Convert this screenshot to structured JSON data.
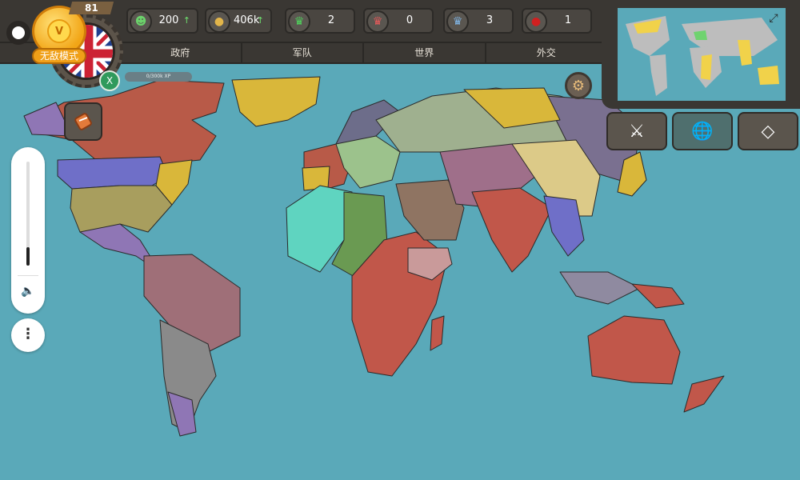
{
  "player": {
    "level": "81",
    "mode_label": "无敌模式",
    "medal_letter": "V",
    "x_badge": "X",
    "xp_text": "0/300k XP"
  },
  "stats": [
    {
      "icon": "happiness-icon",
      "glyph": "☻",
      "color": "#6bd36b",
      "value": "200",
      "trend": "↑"
    },
    {
      "icon": "gold-coins-icon",
      "glyph": "●",
      "color": "#e2b54a",
      "value": "406k",
      "trend": "↑"
    },
    {
      "icon": "green-crown-icon",
      "glyph": "♛",
      "color": "#4fd25c",
      "value": "2",
      "trend": ""
    },
    {
      "icon": "red-crown-icon",
      "glyph": "♛",
      "color": "#e05a5a",
      "value": "0",
      "trend": ""
    },
    {
      "icon": "blue-crown-icon",
      "glyph": "♛",
      "color": "#7fb2e0",
      "value": "3",
      "trend": ""
    },
    {
      "icon": "japan-flag-icon",
      "glyph": "●",
      "color": "#d02020",
      "value": "1",
      "trend": ""
    }
  ],
  "tabs": [
    "政府",
    "军队",
    "世界",
    "外交"
  ],
  "colors": {
    "ocean": "#5aa9b9",
    "panel": "#3a3733",
    "player_red": "#c1574a",
    "gold": "#f0a018"
  },
  "icons": {
    "zoom_speaker": "speaker-icon",
    "more": "more-vertical-icon",
    "expand": "expand-icon",
    "sword": "sword-icon",
    "globe": "globe-icon",
    "diamond": "diamond-icon",
    "settings": "gear-icon",
    "scroll": "scroll-icon"
  },
  "zoom_level": 0.18
}
